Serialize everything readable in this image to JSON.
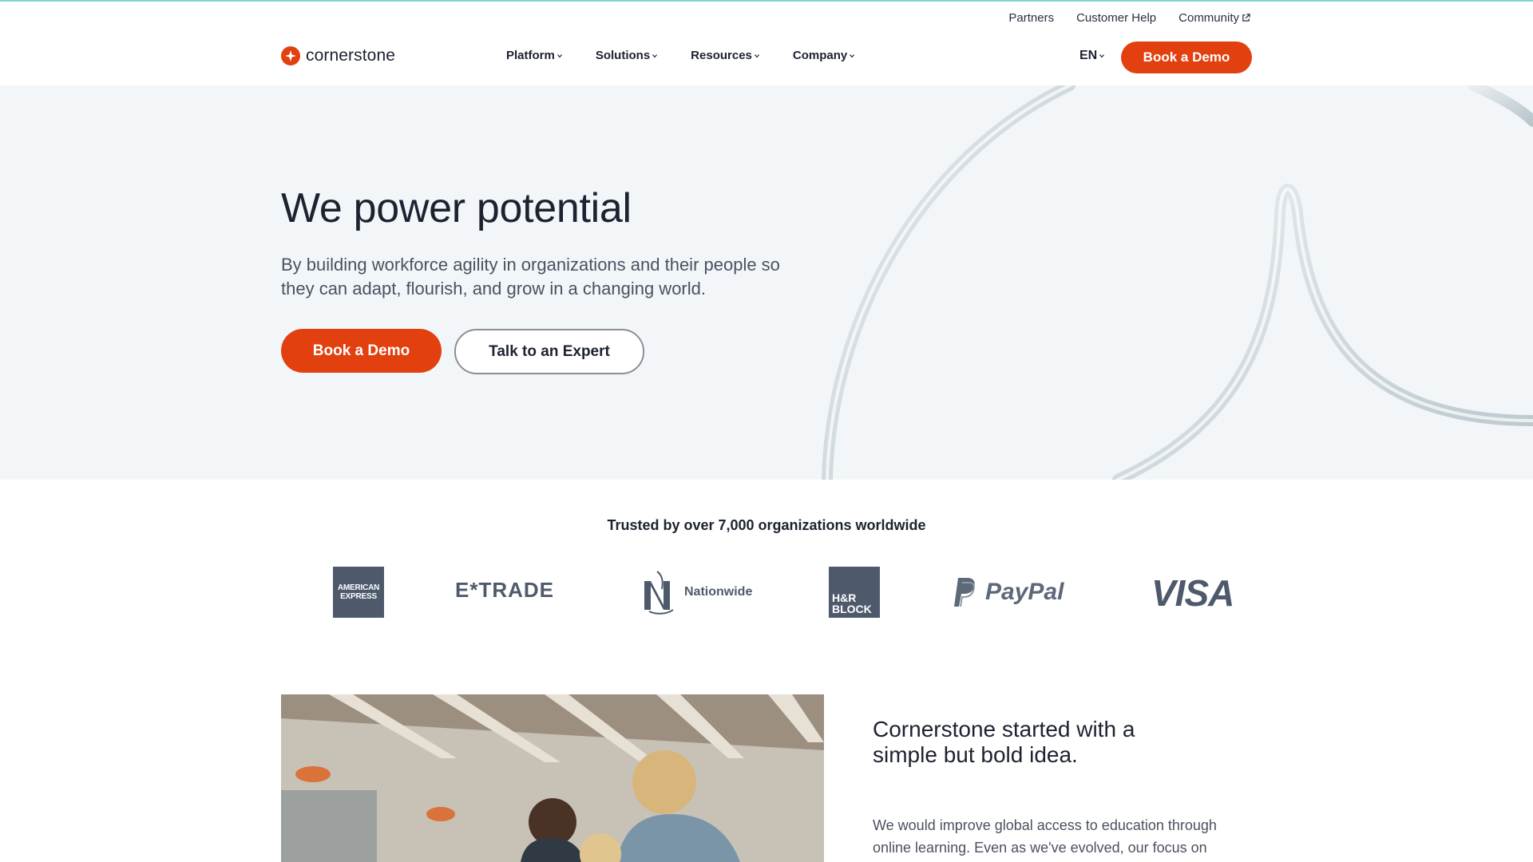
{
  "utility_nav": {
    "partners": "Partners",
    "customer_help": "Customer Help",
    "community": "Community"
  },
  "brand": {
    "name": "cornerstone",
    "accent_color": "#e2400f"
  },
  "main_nav": {
    "items": [
      {
        "label": "Platform"
      },
      {
        "label": "Solutions"
      },
      {
        "label": "Resources"
      },
      {
        "label": "Company"
      }
    ],
    "language": "EN",
    "cta": "Book a Demo"
  },
  "hero": {
    "title": "We power potential",
    "subtitle": "By building workforce agility in organizations and their people so they can adapt, flourish, and grow in a changing world.",
    "primary_cta": "Book a Demo",
    "secondary_cta": "Talk to an Expert"
  },
  "trusted": {
    "heading": "Trusted by over 7,000 organizations worldwide",
    "logos": {
      "amex_line1": "AMERICAN",
      "amex_line2": "EXPRESS",
      "etrade": "E*TRADE",
      "nationwide": "Nationwide",
      "hrblock_line1": "H&R",
      "hrblock_line2": "BLOCK",
      "paypal": "PayPal",
      "visa": "VISA"
    }
  },
  "story": {
    "title": "Cornerstone started with a simple but bold idea.",
    "text": "We would improve global access to education through online learning. Even as we've evolved, our focus on"
  }
}
